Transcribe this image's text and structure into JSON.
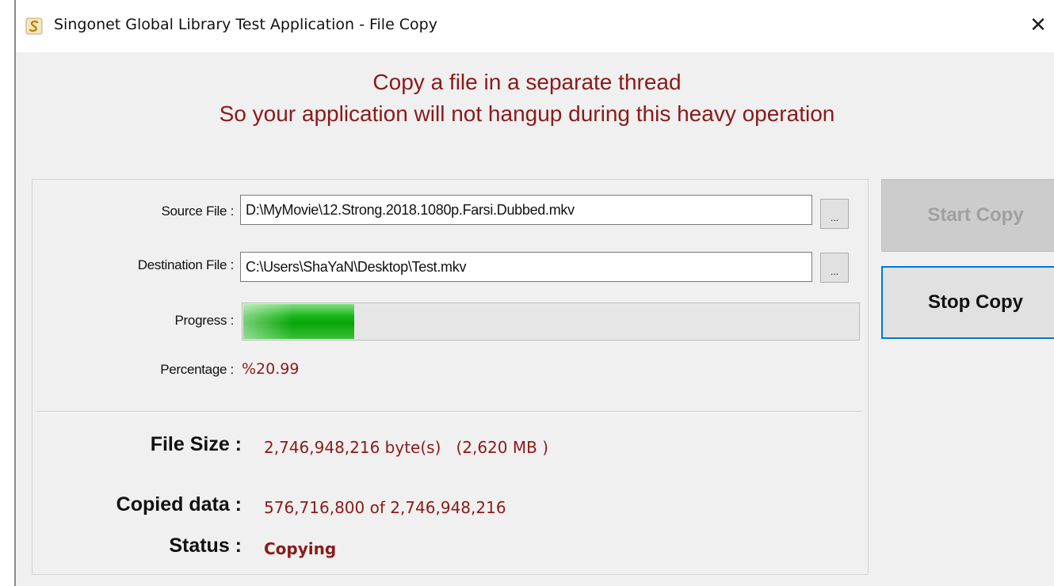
{
  "window": {
    "title": "Singonet Global Library Test Application - File Copy",
    "close_glyph": "✕",
    "icon": "app-logo-icon"
  },
  "headline": {
    "line1": "Copy a file in a separate thread",
    "line2": "So your application will not hangup during this heavy operation"
  },
  "form": {
    "source_label": "Source File :",
    "source_value": "D:\\MyMovie\\12.Strong.2018.1080p.Farsi.Dubbed.mkv",
    "destination_label": "Destination File :",
    "destination_value": "C:\\Users\\ShaYaN\\Desktop\\Test.mkv",
    "browse_label": "...",
    "progress_label": "Progress :",
    "progress_fraction": 0.1799,
    "percentage_label": "Percentage :",
    "percentage_value": "%20.99"
  },
  "info": {
    "file_size_label": "File Size :",
    "file_size_value": "2,746,948,216 byte(s)   (2,620 MB )",
    "copied_label": "Copied data :",
    "copied_value": "576,716,800 of 2,746,948,216",
    "status_label": "Status :",
    "status_value": "Copying"
  },
  "buttons": {
    "start_label": "Start Copy",
    "stop_label": "Stop Copy"
  },
  "colors": {
    "accent_text": "#8b1a1a",
    "progress_green": "#06a606",
    "focus_border": "#0078d7"
  }
}
